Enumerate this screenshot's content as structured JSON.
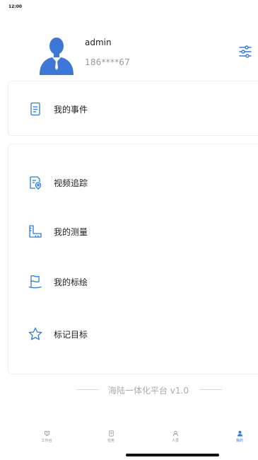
{
  "status_bar": {
    "time": "12:00"
  },
  "profile": {
    "username": "admin",
    "phone": "186****67",
    "avatar_icon": "user-avatar-icon",
    "settings_icon": "sliders-icon"
  },
  "menu_primary": [
    {
      "label": "我的事件",
      "icon": "document-icon"
    }
  ],
  "menu_secondary": [
    {
      "label": "视频追踪",
      "icon": "video-track-icon"
    },
    {
      "label": "我的测量",
      "icon": "ruler-icon"
    },
    {
      "label": "我的标绘",
      "icon": "flag-icon"
    },
    {
      "label": "标记目标",
      "icon": "star-icon"
    }
  ],
  "footer": {
    "version_text": "海陆一体化平台 v1.0"
  },
  "tabbar": {
    "tabs": [
      {
        "label": "工作台",
        "icon": "workbench-icon",
        "active": false
      },
      {
        "label": "任务",
        "icon": "task-icon",
        "active": false
      },
      {
        "label": "人员",
        "icon": "people-icon",
        "active": false
      },
      {
        "label": "我的",
        "icon": "person-icon",
        "active": true
      }
    ]
  },
  "colors": {
    "accent": "#2a7ae4",
    "avatar": "#3c78d8",
    "text_primary": "#222222",
    "text_secondary": "#999999",
    "footer_text": "#aaaaaa",
    "card_border": "#eeeeee"
  }
}
